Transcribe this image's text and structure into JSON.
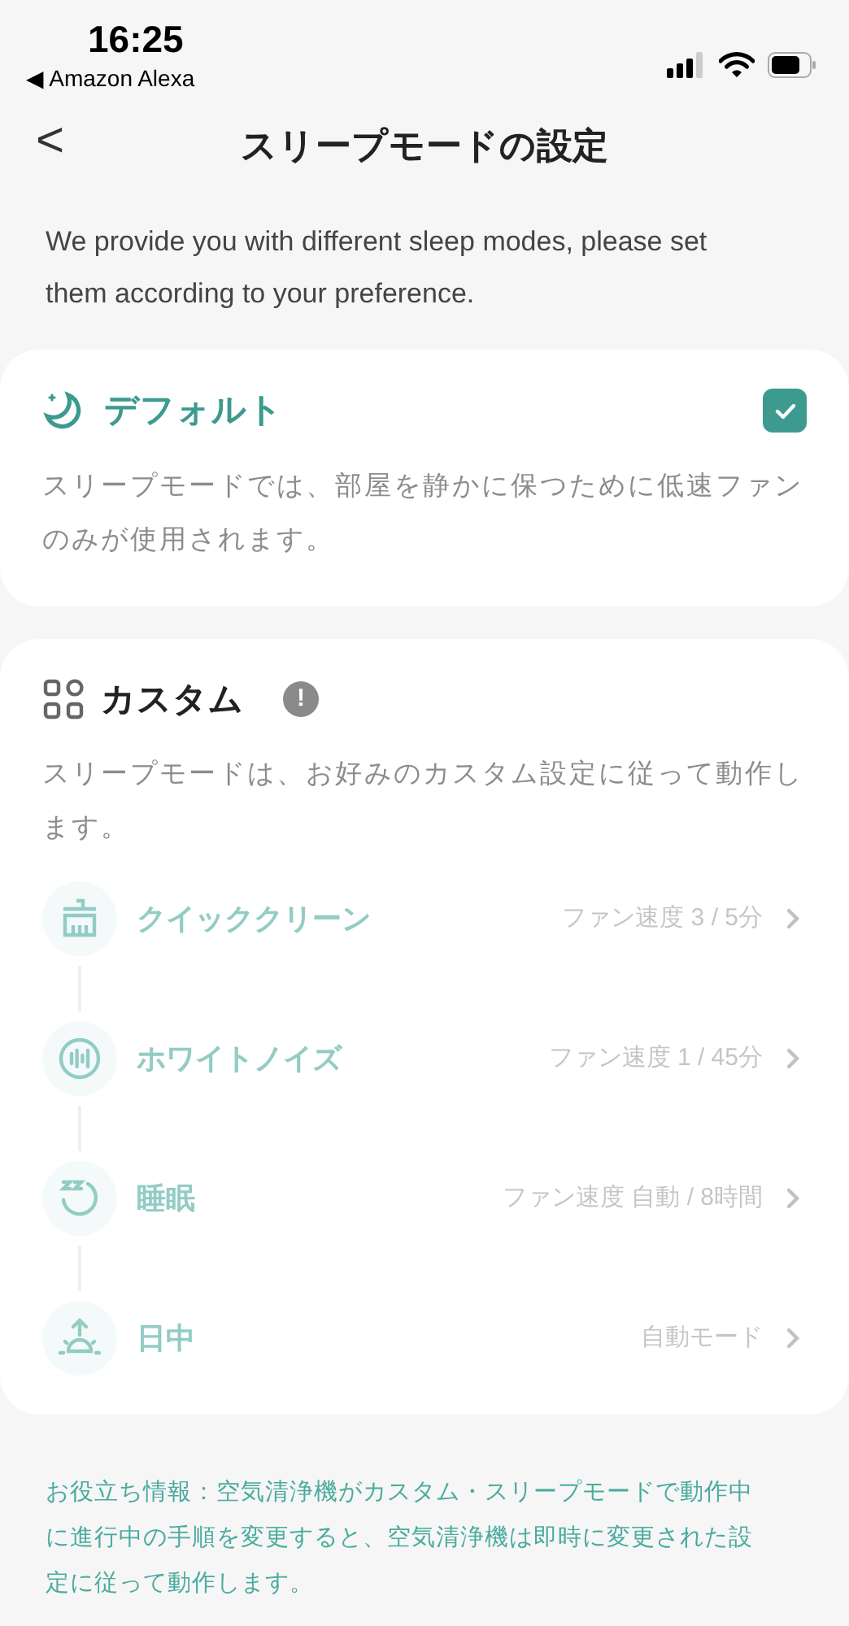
{
  "status_bar": {
    "time": "16:25",
    "back_app": "◀ Amazon Alexa"
  },
  "header": {
    "back": "<",
    "title": "スリープモードの設定"
  },
  "intro": "We provide you with different sleep modes, please set them according to your preference.",
  "modes": [
    {
      "kind": "default",
      "title": "デフォルト",
      "selected": true,
      "description": "スリープモードでは、部屋を静かに保つために低速ファンのみが使用されます。"
    },
    {
      "kind": "custom",
      "title": "カスタム",
      "selected": false,
      "info": "!",
      "description": "スリープモードは、お好みのカスタム設定に従って動作します。",
      "steps": [
        {
          "kind": "clean",
          "label": "クイッククリーン",
          "detail": "ファン速度 3 / 5分"
        },
        {
          "kind": "noise",
          "label": "ホワイトノイズ",
          "detail": "ファン速度 1 / 45分"
        },
        {
          "kind": "sleep",
          "label": "睡眠",
          "detail": "ファン速度 自動 / 8時間"
        },
        {
          "kind": "day",
          "label": "日中",
          "detail": "自動モード"
        }
      ]
    }
  ],
  "tip": "お役立ち情報：空気清浄機がカスタム・スリープモードで動作中に進行中の手順を変更すると、空気清浄機は即時に変更された設定に従って動作します。"
}
